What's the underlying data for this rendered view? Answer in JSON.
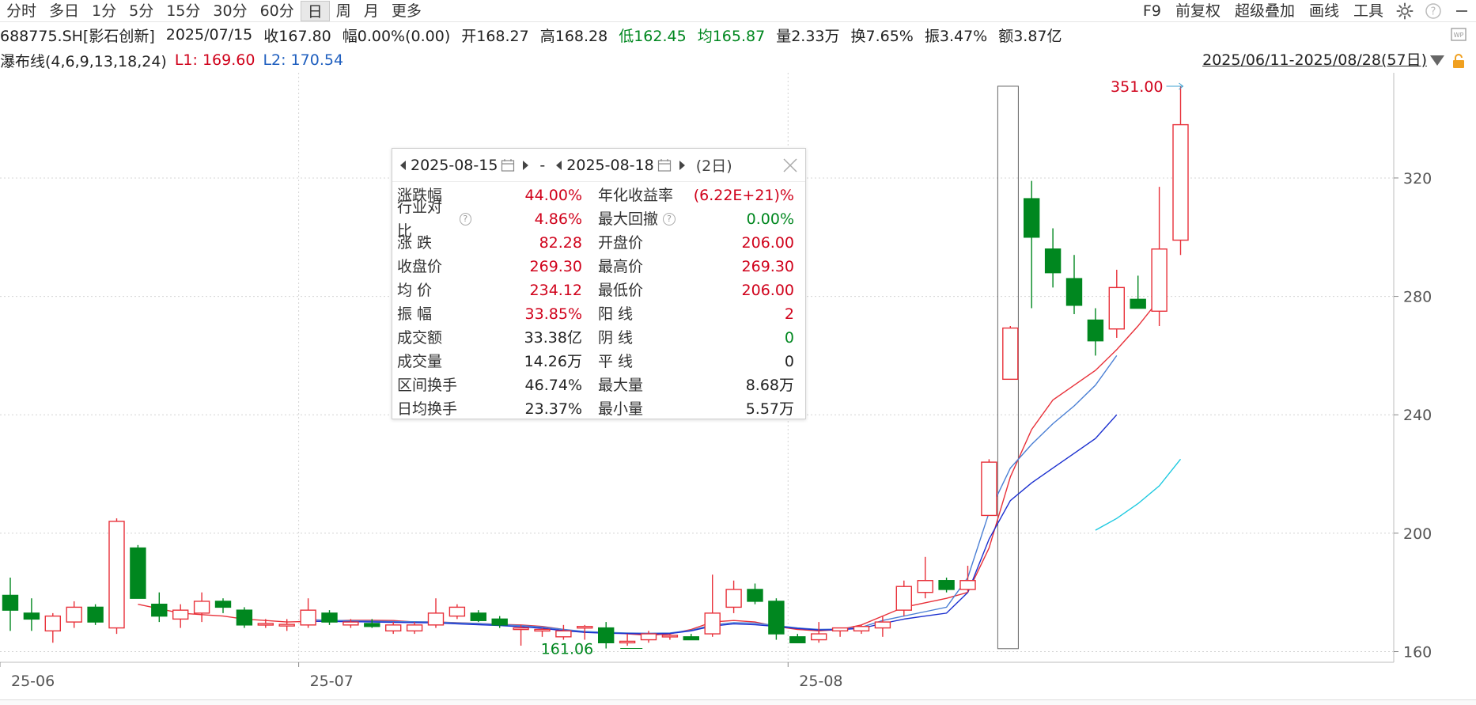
{
  "toolbar": {
    "periods": [
      "分时",
      "多日",
      "1分",
      "5分",
      "15分",
      "30分",
      "60分",
      "日",
      "周",
      "月",
      "更多"
    ],
    "active_period": "日",
    "right_items": [
      "F9",
      "前复权",
      "超级叠加",
      "画线",
      "工具"
    ],
    "icons": [
      "gear-icon",
      "help-icon",
      "minimize-icon"
    ]
  },
  "info": {
    "code": "688775.SH[影石创新]",
    "date": "2025/07/15",
    "close": "收167.80",
    "change": "幅0.00%(0.00)",
    "open": "开168.27",
    "high": "高168.28",
    "low": "低162.45",
    "avg": "均165.87",
    "vol": "量2.33万",
    "turnover": "换7.65%",
    "amplitude": "振3.47%",
    "amount": "额3.87亿"
  },
  "indicator": {
    "name": "瀑布线(4,6,9,13,18,24)",
    "l1": "L1: 169.60",
    "l2": "L2: 170.54",
    "range": "2025/06/11-2025/08/28(57日)"
  },
  "popup": {
    "date_from": "2025-08-15",
    "date_to": "2025-08-18",
    "separator": "-",
    "days": "(2日)",
    "rows": [
      {
        "l1": "涨跌幅",
        "v1": "44.00%",
        "c1": "red",
        "l2": "年化收益率",
        "v2": "(6.22E+21)%",
        "c2": "red",
        "q1": false,
        "q2": false
      },
      {
        "l1": "行业对比",
        "v1": "4.86%",
        "c1": "red",
        "l2": "最大回撤",
        "v2": "0.00%",
        "c2": "green",
        "q1": true,
        "q2": true
      },
      {
        "l1": "涨 跌",
        "v1": "82.28",
        "c1": "red",
        "l2": "开盘价",
        "v2": "206.00",
        "c2": "red",
        "q1": false,
        "q2": false
      },
      {
        "l1": "收盘价",
        "v1": "269.30",
        "c1": "red",
        "l2": "最高价",
        "v2": "269.30",
        "c2": "red",
        "q1": false,
        "q2": false
      },
      {
        "l1": "均 价",
        "v1": "234.12",
        "c1": "red",
        "l2": "最低价",
        "v2": "206.00",
        "c2": "red",
        "q1": false,
        "q2": false
      },
      {
        "l1": "振 幅",
        "v1": "33.85%",
        "c1": "red",
        "l2": "阳 线",
        "v2": "2",
        "c2": "red",
        "q1": false,
        "q2": false
      },
      {
        "l1": "成交额",
        "v1": "33.38亿",
        "c1": "black",
        "l2": "阴 线",
        "v2": "0",
        "c2": "green",
        "q1": false,
        "q2": false
      },
      {
        "l1": "成交量",
        "v1": "14.26万",
        "c1": "black",
        "l2": "平 线",
        "v2": "0",
        "c2": "black",
        "q1": false,
        "q2": false
      },
      {
        "l1": "区间换手",
        "v1": "46.74%",
        "c1": "black",
        "l2": "最大量",
        "v2": "8.68万",
        "c2": "black",
        "q1": false,
        "q2": false
      },
      {
        "l1": "日均换手",
        "v1": "23.37%",
        "c1": "black",
        "l2": "最小量",
        "v2": "5.57万",
        "c2": "black",
        "q1": false,
        "q2": false
      }
    ]
  },
  "colors": {
    "up": "#e8313a",
    "down": "#00871f",
    "l1": "#e8313a",
    "l2": "#4a7fd4",
    "l3": "#1a2fcf",
    "l4": "#1ec9e0",
    "grid": "#d4d4d4"
  },
  "chart_data": {
    "type": "candlestick",
    "x_ticks": [
      "25-06",
      "25-07",
      "25-08"
    ],
    "x_tick_index": [
      0,
      14,
      37
    ],
    "ylim": [
      158,
      355
    ],
    "y_ticks": [
      160,
      200,
      240,
      280,
      320
    ],
    "max_label": "351.00",
    "min_label": "161.06",
    "candles": [
      {
        "o": 179,
        "h": 185,
        "l": 167,
        "c": 174
      },
      {
        "o": 173,
        "h": 178,
        "l": 167,
        "c": 171
      },
      {
        "o": 167,
        "h": 173,
        "l": 163,
        "c": 172
      },
      {
        "o": 170,
        "h": 177,
        "l": 168,
        "c": 175
      },
      {
        "o": 175,
        "h": 176,
        "l": 169,
        "c": 170
      },
      {
        "o": 168,
        "h": 205,
        "l": 166,
        "c": 204
      },
      {
        "o": 195,
        "h": 196,
        "l": 178,
        "c": 178
      },
      {
        "o": 176,
        "h": 180,
        "l": 170,
        "c": 172
      },
      {
        "o": 171,
        "h": 176,
        "l": 168,
        "c": 174
      },
      {
        "o": 173,
        "h": 180,
        "l": 170,
        "c": 177
      },
      {
        "o": 177,
        "h": 178,
        "l": 173,
        "c": 175
      },
      {
        "o": 174,
        "h": 175,
        "l": 168,
        "c": 169
      },
      {
        "o": 169,
        "h": 171,
        "l": 168,
        "c": 169.5
      },
      {
        "o": 169,
        "h": 171,
        "l": 167,
        "c": 169.2
      },
      {
        "o": 169,
        "h": 178,
        "l": 168,
        "c": 174
      },
      {
        "o": 173,
        "h": 174,
        "l": 169,
        "c": 170
      },
      {
        "o": 169,
        "h": 171,
        "l": 168,
        "c": 170
      },
      {
        "o": 169.5,
        "h": 171,
        "l": 168,
        "c": 168.5
      },
      {
        "o": 167,
        "h": 170,
        "l": 166,
        "c": 169
      },
      {
        "o": 167,
        "h": 170,
        "l": 166,
        "c": 169
      },
      {
        "o": 169,
        "h": 178,
        "l": 168,
        "c": 173
      },
      {
        "o": 172,
        "h": 176,
        "l": 171,
        "c": 175
      },
      {
        "o": 173,
        "h": 174,
        "l": 170,
        "c": 170.5
      },
      {
        "o": 171,
        "h": 172,
        "l": 168,
        "c": 169
      },
      {
        "o": 168,
        "h": 169,
        "l": 162,
        "c": 168
      },
      {
        "o": 167,
        "h": 168,
        "l": 165,
        "c": 167.5
      },
      {
        "o": 165,
        "h": 169,
        "l": 164,
        "c": 167
      },
      {
        "o": 168,
        "h": 169,
        "l": 164,
        "c": 168.5
      },
      {
        "o": 168,
        "h": 170,
        "l": 161.06,
        "c": 163
      },
      {
        "o": 163,
        "h": 166,
        "l": 162,
        "c": 163.5
      },
      {
        "o": 164,
        "h": 167,
        "l": 163,
        "c": 166
      },
      {
        "o": 165,
        "h": 166,
        "l": 164,
        "c": 165.5
      },
      {
        "o": 165,
        "h": 166,
        "l": 164,
        "c": 164
      },
      {
        "o": 166,
        "h": 186,
        "l": 165,
        "c": 173
      },
      {
        "o": 175,
        "h": 184,
        "l": 173,
        "c": 181
      },
      {
        "o": 181,
        "h": 183,
        "l": 176,
        "c": 177
      },
      {
        "o": 177,
        "h": 178,
        "l": 164,
        "c": 166
      },
      {
        "o": 165,
        "h": 166,
        "l": 163,
        "c": 163
      },
      {
        "o": 164,
        "h": 170,
        "l": 163,
        "c": 166
      },
      {
        "o": 167,
        "h": 168,
        "l": 165,
        "c": 168
      },
      {
        "o": 167,
        "h": 169,
        "l": 166,
        "c": 168.5
      },
      {
        "o": 168,
        "h": 172,
        "l": 165,
        "c": 170
      },
      {
        "o": 174,
        "h": 184,
        "l": 172,
        "c": 182
      },
      {
        "o": 180,
        "h": 192,
        "l": 178,
        "c": 184
      },
      {
        "o": 184,
        "h": 185,
        "l": 180,
        "c": 181
      },
      {
        "o": 181,
        "h": 189,
        "l": 180,
        "c": 184
      },
      {
        "o": 206,
        "h": 225,
        "l": 206,
        "c": 224
      },
      {
        "o": 252,
        "h": 270,
        "l": 252,
        "c": 269.3
      },
      {
        "o": 313,
        "h": 319,
        "l": 276,
        "c": 300
      },
      {
        "o": 296,
        "h": 303,
        "l": 283,
        "c": 288
      },
      {
        "o": 286,
        "h": 294,
        "l": 274,
        "c": 277
      },
      {
        "o": 272,
        "h": 276,
        "l": 260,
        "c": 265
      },
      {
        "o": 269,
        "h": 289,
        "l": 266,
        "c": 283
      },
      {
        "o": 279,
        "h": 287,
        "l": 276,
        "c": 276
      },
      {
        "o": 275,
        "h": 317,
        "l": 270,
        "c": 296
      },
      {
        "o": 299,
        "h": 351,
        "l": 294,
        "c": 338
      }
    ],
    "series": [
      {
        "color_key": "l1",
        "start": 6,
        "values": [
          176,
          174.5,
          173,
          172.5,
          172,
          171,
          170.5,
          170,
          170.2,
          170.4,
          170.6,
          170.6,
          170.5,
          170,
          170,
          169.8,
          169.5,
          169.2,
          169,
          168.5,
          167.5,
          166.5,
          166.5,
          166,
          165.5,
          166,
          167.5,
          170,
          170.5,
          170,
          168.5,
          167.5,
          167,
          167.5,
          169,
          172,
          175,
          176.5,
          178,
          180,
          195,
          219,
          235,
          245,
          250,
          255,
          262,
          270,
          279
        ]
      },
      {
        "color_key": "l2",
        "start": 14,
        "values": [
          170.8,
          170.6,
          170.4,
          170.3,
          170.2,
          170.1,
          170,
          169.7,
          169.5,
          169.1,
          168.8,
          168.3,
          167.5,
          166.8,
          166.5,
          166.3,
          166.2,
          166.3,
          167.2,
          169,
          169.8,
          169.6,
          168.8,
          168,
          167.5,
          167.6,
          168.2,
          170.5,
          172,
          173.5,
          175,
          185,
          207,
          222,
          230,
          237,
          243,
          250,
          260
        ]
      },
      {
        "color_key": "l3",
        "start": 14,
        "values": [
          170.3,
          170.2,
          170.1,
          170,
          169.9,
          169.8,
          169.7,
          169.4,
          169.1,
          168.8,
          168.4,
          167.9,
          167.1,
          166.5,
          166.2,
          166.1,
          166,
          166.1,
          167,
          168.6,
          169.4,
          169.1,
          168.5,
          167.8,
          167.3,
          167.4,
          167.9,
          169.5,
          171,
          172,
          173,
          180,
          198,
          211,
          217,
          222,
          227,
          232,
          240
        ]
      },
      {
        "color_key": "l4",
        "start": 51,
        "values": [
          201,
          205,
          210,
          216,
          225
        ]
      }
    ]
  }
}
